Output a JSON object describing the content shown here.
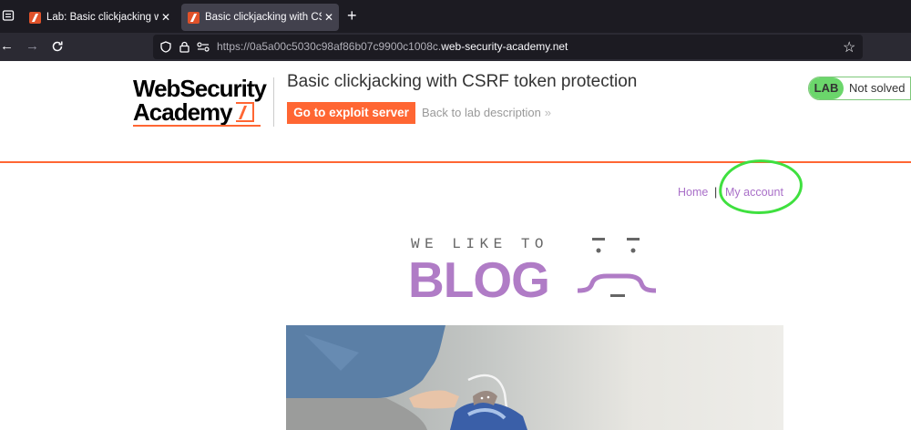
{
  "browser": {
    "tabs": [
      {
        "title": "Lab: Basic clickjacking with CSRF",
        "active": false
      },
      {
        "title": "Basic clickjacking with CSRF toke",
        "active": true
      }
    ],
    "url_prefix": "https://0a5a00c5030c98af86b07c9900c1008c.",
    "url_domain": "web-security-academy.net"
  },
  "header": {
    "logo_line1": "WebSecurity",
    "logo_line2": "Academy",
    "lab_title": "Basic clickjacking with CSRF token protection",
    "exploit_button": "Go to exploit server",
    "back_link": "Back to lab description",
    "status_badge": "LAB",
    "status_text": "Not solved",
    "status_color": "#6bd66b"
  },
  "nav": {
    "home": "Home",
    "separator": "|",
    "my_account": "My account"
  },
  "blog": {
    "tagline": "WE LIKE TO",
    "title": "BLOG",
    "accent": "#b07cc6"
  },
  "colors": {
    "brand_orange": "#ff6633",
    "annotation_green": "#3fe03f"
  }
}
